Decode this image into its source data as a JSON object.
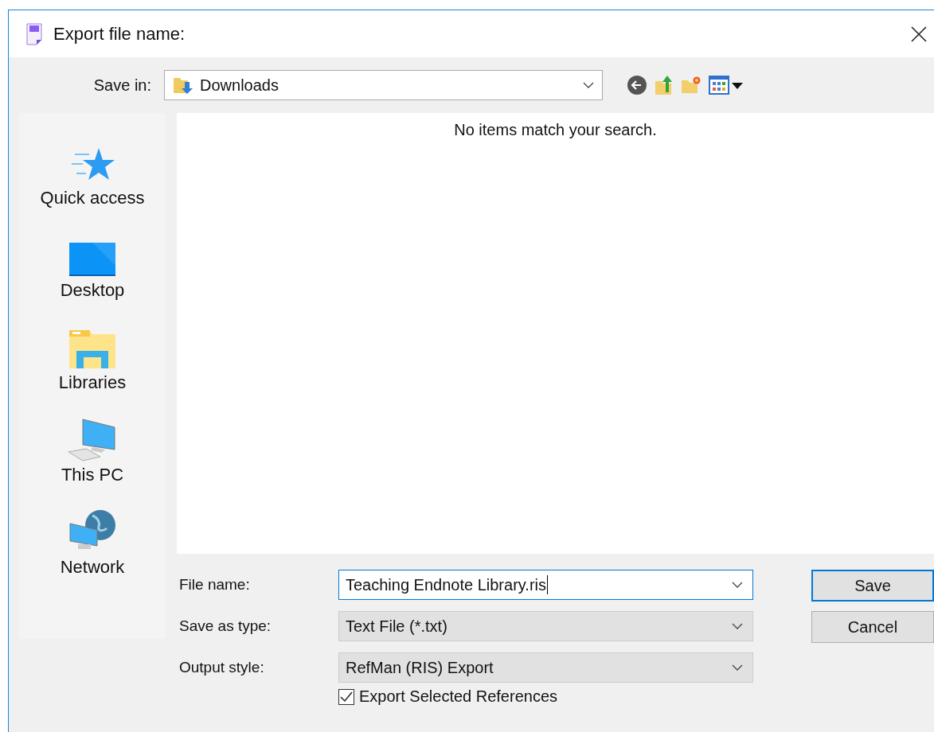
{
  "window": {
    "title": "Export file name:"
  },
  "save_in": {
    "label": "Save in:",
    "value": "Downloads"
  },
  "sidebar": {
    "items": [
      {
        "label": "Quick access",
        "kind": "star"
      },
      {
        "label": "Desktop",
        "kind": "desktop"
      },
      {
        "label": "Libraries",
        "kind": "libraries"
      },
      {
        "label": "This PC",
        "kind": "computer"
      },
      {
        "label": "Network",
        "kind": "network"
      }
    ]
  },
  "file_list": {
    "message": "No items match your search."
  },
  "fields": [
    {
      "label": "File name:",
      "value": "Teaching Endnote Library.ris",
      "kind": "editable",
      "focused": true
    },
    {
      "label": "Save as type:",
      "value": "Text File (*.txt)",
      "kind": "dropdown",
      "focused": false
    },
    {
      "label": "Output style:",
      "value": "RefMan (RIS) Export",
      "kind": "dropdown",
      "focused": false
    }
  ],
  "export_selected": {
    "label": "Export Selected References",
    "checked": true
  },
  "buttons": [
    {
      "label": "Save",
      "default": true
    },
    {
      "label": "Cancel",
      "default": false
    }
  ]
}
